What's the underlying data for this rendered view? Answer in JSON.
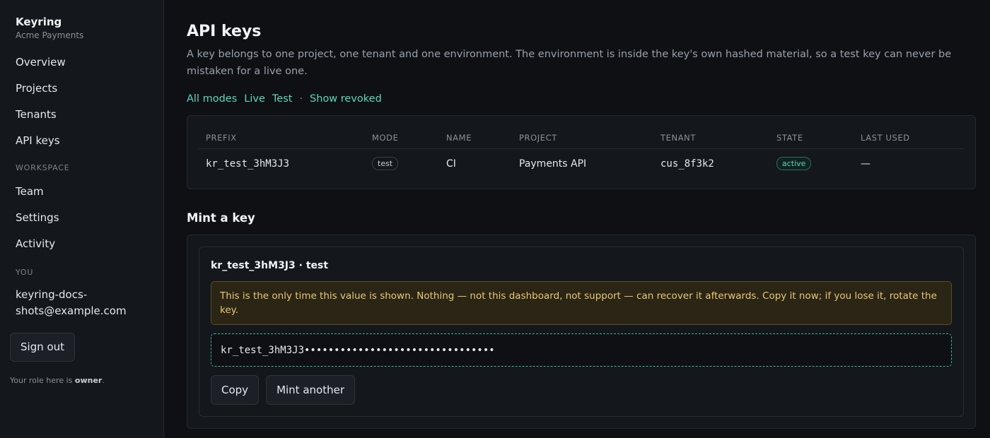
{
  "sidebar": {
    "brand": "Keyring",
    "org": "Acme Payments",
    "nav": [
      "Overview",
      "Projects",
      "Tenants",
      "API keys"
    ],
    "workspace_label": "WORKSPACE",
    "workspace": [
      "Team",
      "Settings",
      "Activity"
    ],
    "you_label": "YOU",
    "email": "keyring-docs-shots@example.com",
    "signout": "Sign out",
    "role_prefix": "Your role here is ",
    "role": "owner",
    "role_suffix": "."
  },
  "header": {
    "title": "API keys",
    "lead": "A key belongs to one project, one tenant and one environment. The environment is inside the key's own hashed material, so a test key can never be mistaken for a live one."
  },
  "filters": {
    "all": "All modes",
    "live": "Live",
    "test": "Test",
    "sep": "·",
    "revoked": "Show revoked"
  },
  "table": {
    "columns": [
      "PREFIX",
      "MODE",
      "NAME",
      "PROJECT",
      "TENANT",
      "STATE",
      "LAST USED"
    ],
    "rows": [
      {
        "prefix": "kr_test_3hM3J3",
        "mode": "test",
        "name": "CI",
        "project": "Payments API",
        "tenant": "cus_8f3k2",
        "state": "active",
        "last_used": "—"
      }
    ]
  },
  "mint": {
    "title": "Mint a key",
    "key_head": "kr_test_3hM3J3 · test",
    "warning": "This is the only time this value is shown. Nothing — not this dashboard, not support — can recover it afterwards. Copy it now; if you lose it, rotate the key.",
    "secret": "kr_test_3hM3J3••••••••••••••••••••••••••••••••",
    "copy": "Copy",
    "again": "Mint another"
  },
  "colors": {
    "accent": "#5cd6c0",
    "background": "#0e1014",
    "warning_text": "#e8c874"
  }
}
